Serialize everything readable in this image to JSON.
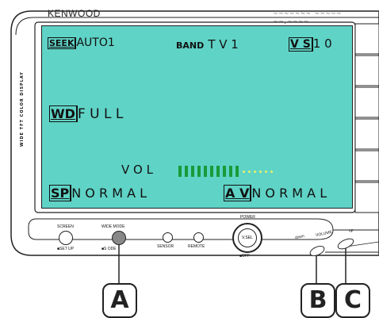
{
  "device": {
    "brand": "KENWOOD",
    "side_label": "WIDE TFT COLOR DISPLAY"
  },
  "screen": {
    "seek_label": "SEEK",
    "seek_value": "AUTO1",
    "band_label": "BAND",
    "band_value": "T V 1",
    "vs_label": "V S",
    "vs_value": "1 0",
    "wd_label": "WD",
    "wd_value": "F U L L",
    "vol_label": "V O L",
    "vol_level": 10,
    "vol_max": 16,
    "sp_label": "SP",
    "sp_value": "N O R M A L",
    "av_label": "A V",
    "av_value": "N O R M A L"
  },
  "controls": {
    "screen_label": "SCREEN",
    "setup_label": "SET UP",
    "wide_mode_label": "WIDE MODE",
    "wide_mode_sub": "S   ODE",
    "sensor_label": "SENSOR",
    "remote_label": "REMOTE",
    "power_label": "POWER",
    "vsel_label": "V.SEL",
    "off_label": "OFF",
    "volume_label": "VOLUME",
    "volume_down": "down",
    "volume_up": "up"
  },
  "callouts": {
    "a": "A",
    "b": "B",
    "c": "C"
  },
  "colors": {
    "screen": "#5fd3c6",
    "vol_bar": "#1a9a3a",
    "vol_dot": "#e8ef6a",
    "wide_mode_button": "#888888"
  }
}
